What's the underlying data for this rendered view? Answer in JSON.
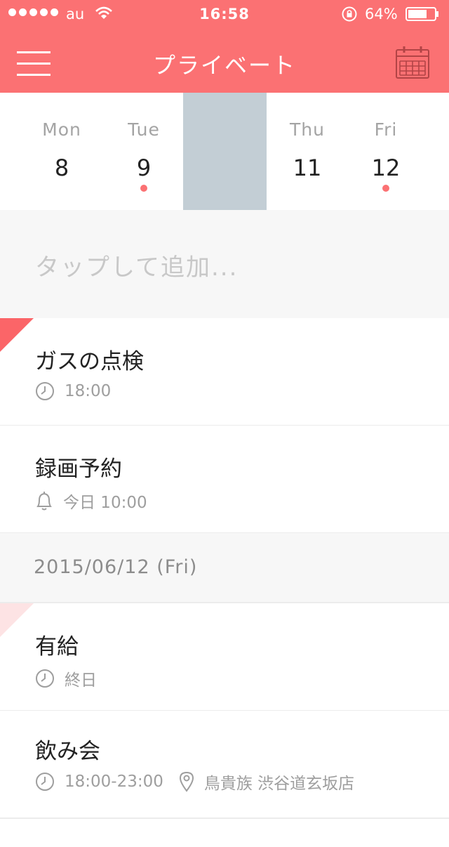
{
  "status_bar": {
    "carrier": "au",
    "time": "16:58",
    "battery": "64%",
    "icons": [
      "signal-dots-icon",
      "wifi-icon",
      "rotation-lock-icon",
      "battery-icon"
    ]
  },
  "nav": {
    "title": "プライベート",
    "left_icon": "hamburger-menu-icon",
    "right_icon": "calendar-icon"
  },
  "week": {
    "days": [
      {
        "name": "Mon",
        "num": "8",
        "has_event": false,
        "selected": false
      },
      {
        "name": "Tue",
        "num": "9",
        "has_event": true,
        "selected": false
      },
      {
        "name": "",
        "num": "",
        "has_event": false,
        "selected": true
      },
      {
        "name": "Thu",
        "num": "11",
        "has_event": false,
        "selected": false
      },
      {
        "name": "Fri",
        "num": "12",
        "has_event": true,
        "selected": false
      }
    ]
  },
  "add": {
    "placeholder": "タップして追加..."
  },
  "events_today": [
    {
      "title": "ガスの点検",
      "icon": "clock-icon",
      "time": "18:00",
      "flag": "#fb6568"
    },
    {
      "title": "録画予約",
      "icon": "bell-icon",
      "time": "今日 10:00"
    }
  ],
  "section": {
    "date": "2015/06/12 (Fri)"
  },
  "events_day": [
    {
      "title": "有給",
      "icon": "clock-icon",
      "time": "終日",
      "flag": "#fde3e4"
    },
    {
      "title": "飲み会",
      "icon": "clock-icon",
      "time": "18:00-23:00",
      "location_icon": "location-pin-icon",
      "location": "鳥貴族 渋谷道玄坂店"
    }
  ],
  "colors": {
    "accent": "#fb7173",
    "selected_day": "#c3ced5",
    "muted_bg": "#f7f7f7"
  }
}
